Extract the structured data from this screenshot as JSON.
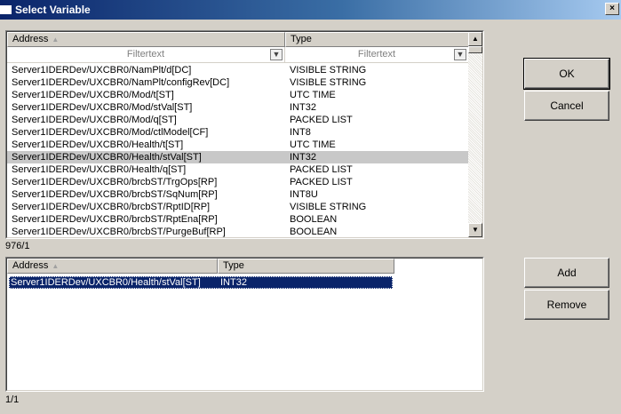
{
  "window": {
    "title": "Select Variable",
    "close_glyph": "×"
  },
  "variables_table": {
    "columns": {
      "address": "Address",
      "type": "Type"
    },
    "filter_placeholder": "Filtertext",
    "rows": [
      {
        "address": "Server1IDERDev/UXCBR0/NamPlt/d[DC]",
        "type": "VISIBLE STRING"
      },
      {
        "address": "Server1IDERDev/UXCBR0/NamPlt/configRev[DC]",
        "type": "VISIBLE STRING"
      },
      {
        "address": "Server1IDERDev/UXCBR0/Mod/t[ST]",
        "type": "UTC TIME"
      },
      {
        "address": "Server1IDERDev/UXCBR0/Mod/stVal[ST]",
        "type": "INT32"
      },
      {
        "address": "Server1IDERDev/UXCBR0/Mod/q[ST]",
        "type": "PACKED LIST"
      },
      {
        "address": "Server1IDERDev/UXCBR0/Mod/ctlModel[CF]",
        "type": "INT8"
      },
      {
        "address": "Server1IDERDev/UXCBR0/Health/t[ST]",
        "type": "UTC TIME"
      },
      {
        "address": "Server1IDERDev/UXCBR0/Health/stVal[ST]",
        "type": "INT32"
      },
      {
        "address": "Server1IDERDev/UXCBR0/Health/q[ST]",
        "type": "PACKED LIST"
      },
      {
        "address": "Server1IDERDev/UXCBR0/brcbST/TrgOps[RP]",
        "type": "PACKED LIST"
      },
      {
        "address": "Server1IDERDev/UXCBR0/brcbST/SqNum[RP]",
        "type": "INT8U"
      },
      {
        "address": "Server1IDERDev/UXCBR0/brcbST/RptID[RP]",
        "type": "VISIBLE STRING"
      },
      {
        "address": "Server1IDERDev/UXCBR0/brcbST/RptEna[RP]",
        "type": "BOOLEAN"
      },
      {
        "address": "Server1IDERDev/UXCBR0/brcbST/PurgeBuf[RP]",
        "type": "BOOLEAN"
      }
    ],
    "status": "976/1"
  },
  "selected_table": {
    "columns": {
      "address": "Address",
      "type": "Type"
    },
    "rows": [
      {
        "address": "Server1IDERDev/UXCBR0/Health/stVal[ST]",
        "type": "INT32"
      }
    ],
    "status": "1/1"
  },
  "buttons": {
    "ok": "OK",
    "cancel": "Cancel",
    "add": "Add",
    "remove": "Remove"
  },
  "icons": {
    "sort": "▲",
    "filter": "▼",
    "scroll_up": "▲",
    "scroll_down": "▼"
  }
}
